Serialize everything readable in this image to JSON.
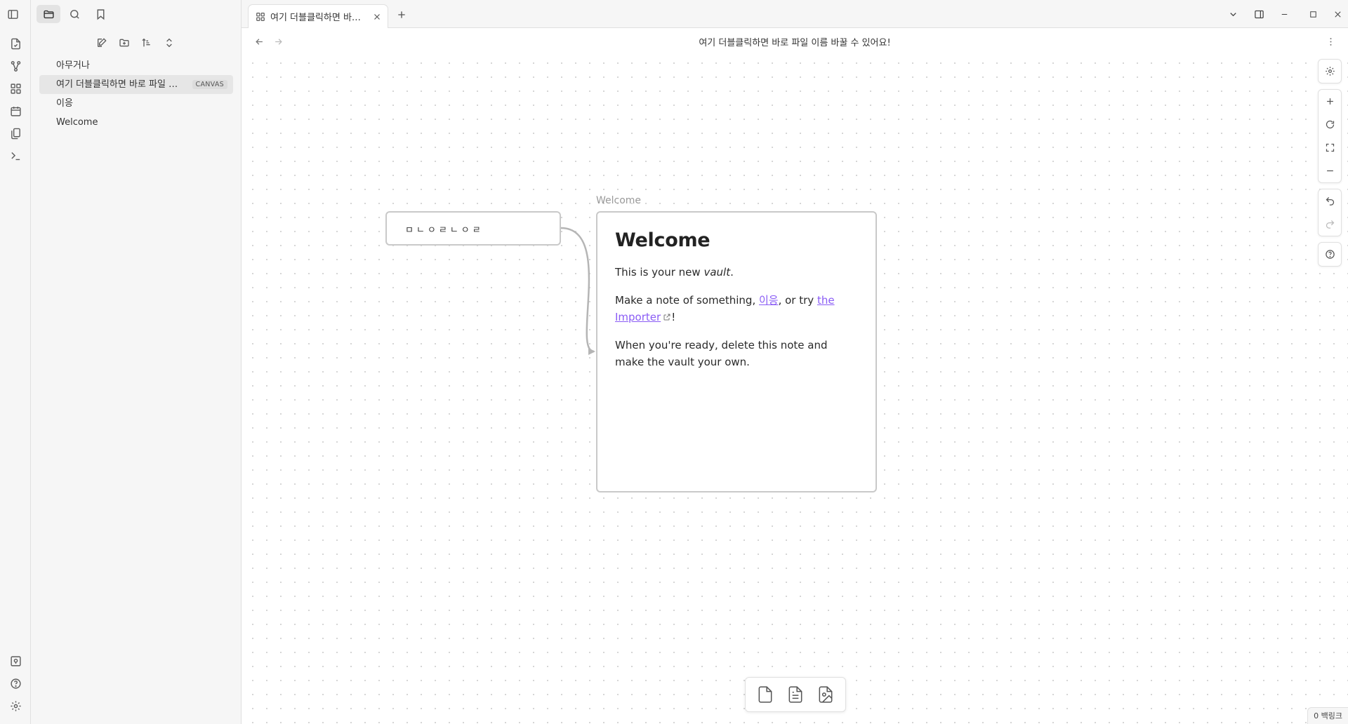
{
  "sidebar": {
    "files": [
      {
        "name": "아무거나",
        "badge": ""
      },
      {
        "name": "여기 더블클릭하면 바로 파일 이름 바꿀 수 있어요!",
        "badge": "CANVAS"
      },
      {
        "name": "이응",
        "badge": ""
      },
      {
        "name": "Welcome",
        "badge": ""
      }
    ]
  },
  "tab": {
    "label": "여기 더블클릭하면 바로 파일 이름 바꿀 수 있어요!"
  },
  "view": {
    "title": "여기 더블클릭하면 바로 파일 이름 바꿀 수 있어요!"
  },
  "canvas": {
    "text_node": "ㅁㄴㅇㄹㄴㅇㄹ",
    "file_node": {
      "label": "Welcome",
      "heading": "Welcome",
      "p1_before": "This is your new ",
      "p1_em": "vault",
      "p1_after": ".",
      "p2_before": "Make a note of something, ",
      "p2_link1": "이응",
      "p2_mid": ", or try ",
      "p2_link2": "the Importer",
      "p2_after": "!",
      "p3": "When you're ready, delete this note and make the vault your own."
    }
  },
  "status_bar": {
    "backlinks": "0 백링크"
  }
}
